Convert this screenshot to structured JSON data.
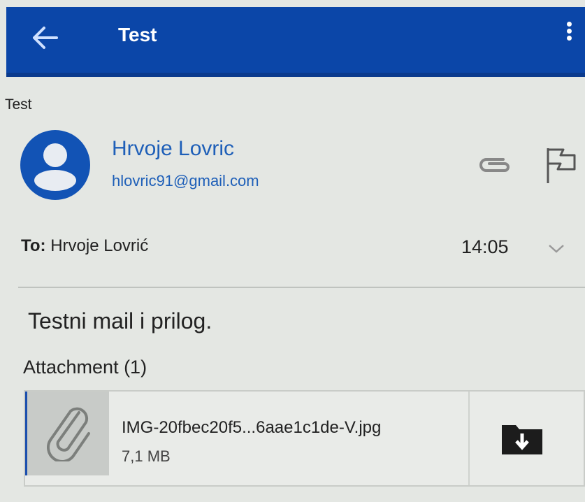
{
  "app_bar": {
    "title": "Test"
  },
  "message": {
    "subject": "Test",
    "sender": {
      "name": "Hrvoje Lovric",
      "email": "hlovric91@gmail.com"
    },
    "to_label": "To:",
    "to_name": "Hrvoje Lovrić",
    "time": "14:05",
    "body": "Testni mail i prilog."
  },
  "attachments": {
    "heading": "Attachment (1)",
    "items": [
      {
        "name": "IMG-20fbec20f5...6aae1c1de-V.jpg",
        "size": "7,1 MB"
      }
    ]
  },
  "icons": {
    "back": "arrow-left-icon",
    "menu": "more-vert-icon",
    "avatar": "person-avatar-icon",
    "attachment": "paperclip-icon",
    "flag": "flag-icon",
    "expand": "chevron-down-icon",
    "download": "folder-download-icon"
  },
  "colors": {
    "app_bar": "#0b46a8",
    "accent": "#1e5fb8",
    "background": "#e4e7e3"
  }
}
